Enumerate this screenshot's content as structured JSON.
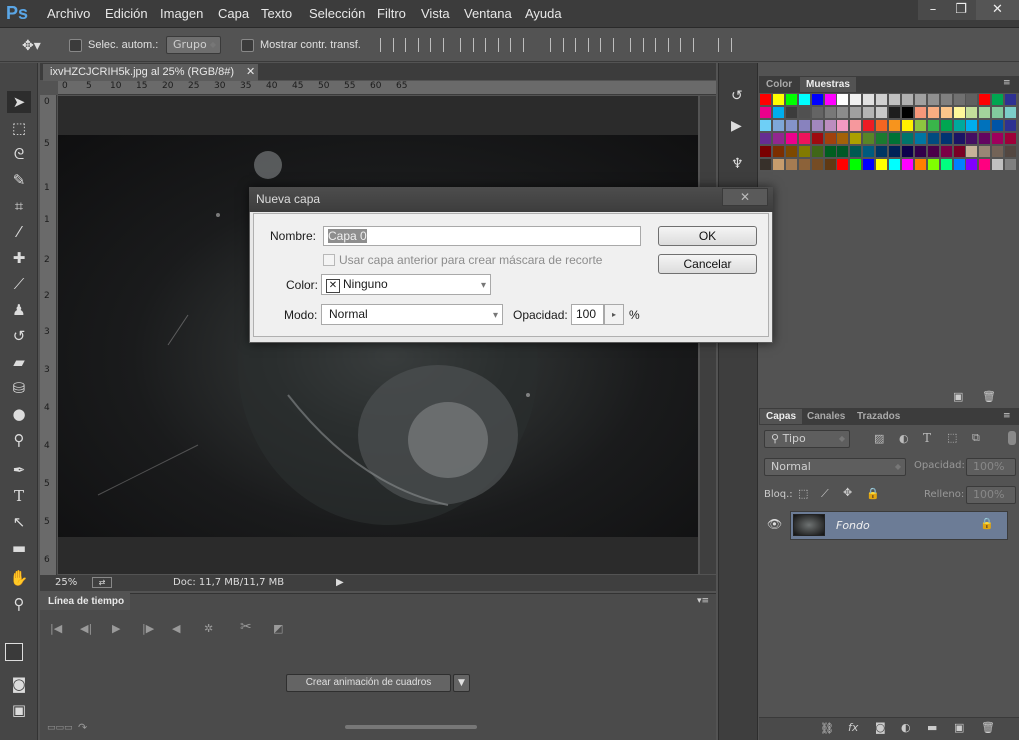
{
  "app": {
    "logo": "Ps"
  },
  "menu": [
    "Archivo",
    "Edición",
    "Imagen",
    "Capa",
    "Texto",
    "Selección",
    "Filtro",
    "Vista",
    "Ventana",
    "Ayuda"
  ],
  "window_controls": {
    "minimize": "–",
    "restore": "❐",
    "close": "✕"
  },
  "options_bar": {
    "auto_select_label": "Selec. autom.:",
    "auto_select_value": "Grupo",
    "transform_label": "Mostrar contr. transf."
  },
  "document": {
    "tab_label": "ixvHZCJCRIH5k.jpg al 25% (RGB/8#)",
    "tab_close": "✕",
    "zoom": "25%",
    "doc_info": "Doc: 11,7 MB/11,7 MB"
  },
  "ruler_top": [
    "0",
    "5",
    "10",
    "15",
    "20",
    "25",
    "30",
    "35",
    "40",
    "45",
    "50",
    "55",
    "60",
    "65"
  ],
  "ruler_left": [
    "0",
    "5",
    "1",
    "1",
    "2",
    "2",
    "3",
    "3",
    "4",
    "4",
    "5",
    "5",
    "6"
  ],
  "timeline": {
    "tab_label": "Línea de tiempo",
    "create_button": "Crear animación de cuadros"
  },
  "right_panel": {
    "swatch_tabs": [
      "Color",
      "Muestras"
    ],
    "layers_tabs": [
      "Capas",
      "Canales",
      "Trazados"
    ],
    "filter_kind": "Tipo",
    "blend_mode": "Normal",
    "opacity_label": "Opacidad:",
    "opacity_value": "100%",
    "lock_label": "Bloq.:",
    "fill_label": "Relleno:",
    "fill_value": "100%",
    "layer_name": "Fondo"
  },
  "dialog": {
    "title": "Nueva capa",
    "name_label": "Nombre:",
    "name_value": "Capa 0",
    "clip_label": "Usar capa anterior para crear máscara de recorte",
    "color_label": "Color:",
    "color_value": "Ninguno",
    "mode_label": "Modo:",
    "mode_value": "Normal",
    "opacity_label": "Opacidad:",
    "opacity_value": "100",
    "percent": "%",
    "ok_label": "OK",
    "cancel_label": "Cancelar"
  },
  "swatch_colors": [
    "#ff0000",
    "#ffff00",
    "#00ff00",
    "#00ffff",
    "#0000ff",
    "#ff00ff",
    "#ffffff",
    "#f0f0f0",
    "#e0e0e0",
    "#d0d0d0",
    "#c0c0c0",
    "#b0b0b0",
    "#a0a0a0",
    "#909090",
    "#808080",
    "#707070",
    "#606060",
    "#ff0000",
    "#00a651",
    "#2e3192",
    "#ec008c",
    "#00aeef",
    "#3c3c3c",
    "#505050",
    "#646464",
    "#787878",
    "#8c8c8c",
    "#a0a0a0",
    "#b4b4b4",
    "#c8c8c8",
    "#1e1e1e",
    "#000000",
    "#f7977a",
    "#f9ad81",
    "#fdc68a",
    "#fff79a",
    "#c4df9b",
    "#a2d39c",
    "#82ca9d",
    "#7bcdc8",
    "#6ecff6",
    "#7ea7d8",
    "#8493ca",
    "#8882be",
    "#a187be",
    "#bc8dbf",
    "#f49ac2",
    "#f6989d",
    "#ed1c24",
    "#f26522",
    "#f7941d",
    "#fff200",
    "#8dc63f",
    "#39b54a",
    "#00a651",
    "#00a99d",
    "#00aeef",
    "#0072bc",
    "#0054a6",
    "#2e3192",
    "#662d91",
    "#92278f",
    "#ec008c",
    "#ed145b",
    "#9e0b0f",
    "#a0410d",
    "#a36209",
    "#aba000",
    "#598527",
    "#1a7b30",
    "#007236",
    "#00746b",
    "#0076a3",
    "#004b80",
    "#003471",
    "#1b1464",
    "#440e62",
    "#630460",
    "#9e005d",
    "#9e0039",
    "#790000",
    "#7b2e00",
    "#7d4900",
    "#827b00",
    "#406618",
    "#005e20",
    "#005826",
    "#005952",
    "#005b7f",
    "#003663",
    "#002157",
    "#0d004c",
    "#32004b",
    "#4b0049",
    "#7b0046",
    "#7a0026",
    "#c7b299",
    "#998675",
    "#736357",
    "#534741",
    "#37302a",
    "#c69c6d",
    "#a67c52",
    "#8c6239",
    "#754c24",
    "#603913",
    "#ff0000",
    "#00ff00",
    "#0000ff",
    "#ffff00",
    "#00ffff",
    "#ff00ff",
    "#ff8000",
    "#80ff00",
    "#00ff80",
    "#0080ff",
    "#8000ff",
    "#ff0080",
    "#c0c0c0",
    "#808080"
  ]
}
